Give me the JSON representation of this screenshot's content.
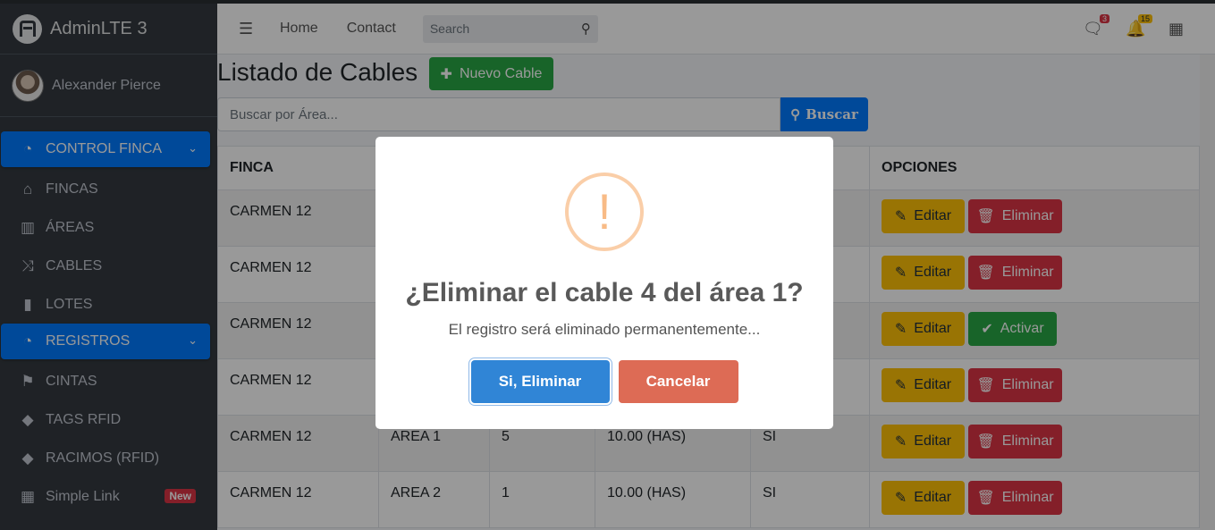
{
  "brand": {
    "title": "AdminLTE 3"
  },
  "user": {
    "name": "Alexander Pierce"
  },
  "sidebar": {
    "items": [
      {
        "label": "CONTROL FINCA",
        "icon": "dashboard-icon",
        "active": true
      },
      {
        "label": "FINCAS",
        "icon": "home-icon"
      },
      {
        "label": "ÁREAS",
        "icon": "map-icon"
      },
      {
        "label": "CABLES",
        "icon": "random-icon"
      },
      {
        "label": "LOTES",
        "icon": "bookmark-icon"
      },
      {
        "label": "REGISTROS",
        "icon": "dashboard-icon",
        "active": true
      },
      {
        "label": "CINTAS",
        "icon": "flag-icon"
      },
      {
        "label": "TAGS RFID",
        "icon": "tag-icon"
      },
      {
        "label": "RACIMOS (RFID)",
        "icon": "tags-icon"
      },
      {
        "label": "Simple Link",
        "icon": "grid-icon",
        "badge": "New"
      }
    ]
  },
  "navbar": {
    "links": [
      "Home",
      "Contact"
    ],
    "search_placeholder": "Search",
    "messages_count": "3",
    "notifications_count": "15"
  },
  "page": {
    "title": "Listado de Cables",
    "new_button": "Nuevo Cable",
    "search_placeholder": "Buscar por Área...",
    "search_button": "Buscar"
  },
  "table": {
    "headers": [
      "FINCA",
      "",
      "",
      "",
      "",
      "OPCIONES"
    ],
    "rows": [
      {
        "finca": "CARMEN 12",
        "area": "",
        "cable": "",
        "size": "",
        "active": "",
        "action": "Eliminar"
      },
      {
        "finca": "CARMEN 12",
        "area": "",
        "cable": "",
        "size": "",
        "active": "",
        "action": "Eliminar"
      },
      {
        "finca": "CARMEN 12",
        "area": "",
        "cable": "",
        "size": "",
        "active": "",
        "action": "Activar"
      },
      {
        "finca": "CARMEN 12",
        "area": "",
        "cable": "",
        "size": "",
        "active": "",
        "action": "Eliminar"
      },
      {
        "finca": "CARMEN 12",
        "area": "AREA 1",
        "cable": "5",
        "size": "10.00 (HAS)",
        "active": "SI",
        "action": "Eliminar"
      },
      {
        "finca": "CARMEN 12",
        "area": "AREA 2",
        "cable": "1",
        "size": "10.00 (HAS)",
        "active": "SI",
        "action": "Eliminar"
      }
    ],
    "edit_label": "Editar"
  },
  "modal": {
    "icon": "!",
    "title": "¿Eliminar el cable 4 del área 1?",
    "text": "El registro será eliminado permanentemente...",
    "confirm": "Si, Eliminar",
    "cancel": "Cancelar"
  }
}
